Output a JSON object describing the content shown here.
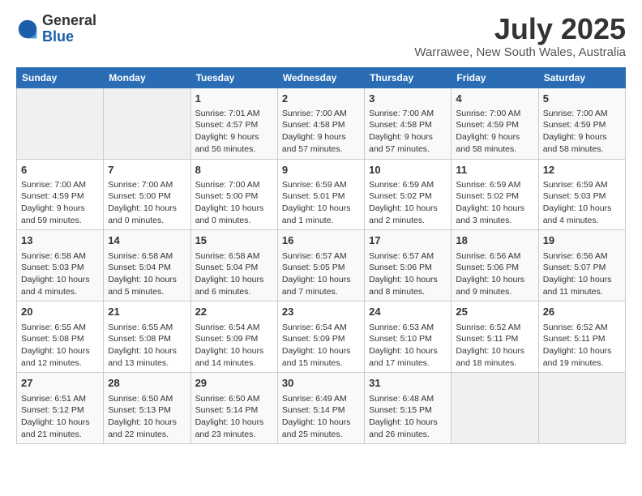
{
  "header": {
    "logo_general": "General",
    "logo_blue": "Blue",
    "month": "July 2025",
    "location": "Warrawee, New South Wales, Australia"
  },
  "days_of_week": [
    "Sunday",
    "Monday",
    "Tuesday",
    "Wednesday",
    "Thursday",
    "Friday",
    "Saturday"
  ],
  "weeks": [
    [
      {
        "day": "",
        "info": ""
      },
      {
        "day": "",
        "info": ""
      },
      {
        "day": "1",
        "info": "Sunrise: 7:01 AM\nSunset: 4:57 PM\nDaylight: 9 hours and 56 minutes."
      },
      {
        "day": "2",
        "info": "Sunrise: 7:00 AM\nSunset: 4:58 PM\nDaylight: 9 hours and 57 minutes."
      },
      {
        "day": "3",
        "info": "Sunrise: 7:00 AM\nSunset: 4:58 PM\nDaylight: 9 hours and 57 minutes."
      },
      {
        "day": "4",
        "info": "Sunrise: 7:00 AM\nSunset: 4:59 PM\nDaylight: 9 hours and 58 minutes."
      },
      {
        "day": "5",
        "info": "Sunrise: 7:00 AM\nSunset: 4:59 PM\nDaylight: 9 hours and 58 minutes."
      }
    ],
    [
      {
        "day": "6",
        "info": "Sunrise: 7:00 AM\nSunset: 4:59 PM\nDaylight: 9 hours and 59 minutes."
      },
      {
        "day": "7",
        "info": "Sunrise: 7:00 AM\nSunset: 5:00 PM\nDaylight: 10 hours and 0 minutes."
      },
      {
        "day": "8",
        "info": "Sunrise: 7:00 AM\nSunset: 5:00 PM\nDaylight: 10 hours and 0 minutes."
      },
      {
        "day": "9",
        "info": "Sunrise: 6:59 AM\nSunset: 5:01 PM\nDaylight: 10 hours and 1 minute."
      },
      {
        "day": "10",
        "info": "Sunrise: 6:59 AM\nSunset: 5:02 PM\nDaylight: 10 hours and 2 minutes."
      },
      {
        "day": "11",
        "info": "Sunrise: 6:59 AM\nSunset: 5:02 PM\nDaylight: 10 hours and 3 minutes."
      },
      {
        "day": "12",
        "info": "Sunrise: 6:59 AM\nSunset: 5:03 PM\nDaylight: 10 hours and 4 minutes."
      }
    ],
    [
      {
        "day": "13",
        "info": "Sunrise: 6:58 AM\nSunset: 5:03 PM\nDaylight: 10 hours and 4 minutes."
      },
      {
        "day": "14",
        "info": "Sunrise: 6:58 AM\nSunset: 5:04 PM\nDaylight: 10 hours and 5 minutes."
      },
      {
        "day": "15",
        "info": "Sunrise: 6:58 AM\nSunset: 5:04 PM\nDaylight: 10 hours and 6 minutes."
      },
      {
        "day": "16",
        "info": "Sunrise: 6:57 AM\nSunset: 5:05 PM\nDaylight: 10 hours and 7 minutes."
      },
      {
        "day": "17",
        "info": "Sunrise: 6:57 AM\nSunset: 5:06 PM\nDaylight: 10 hours and 8 minutes."
      },
      {
        "day": "18",
        "info": "Sunrise: 6:56 AM\nSunset: 5:06 PM\nDaylight: 10 hours and 9 minutes."
      },
      {
        "day": "19",
        "info": "Sunrise: 6:56 AM\nSunset: 5:07 PM\nDaylight: 10 hours and 11 minutes."
      }
    ],
    [
      {
        "day": "20",
        "info": "Sunrise: 6:55 AM\nSunset: 5:08 PM\nDaylight: 10 hours and 12 minutes."
      },
      {
        "day": "21",
        "info": "Sunrise: 6:55 AM\nSunset: 5:08 PM\nDaylight: 10 hours and 13 minutes."
      },
      {
        "day": "22",
        "info": "Sunrise: 6:54 AM\nSunset: 5:09 PM\nDaylight: 10 hours and 14 minutes."
      },
      {
        "day": "23",
        "info": "Sunrise: 6:54 AM\nSunset: 5:09 PM\nDaylight: 10 hours and 15 minutes."
      },
      {
        "day": "24",
        "info": "Sunrise: 6:53 AM\nSunset: 5:10 PM\nDaylight: 10 hours and 17 minutes."
      },
      {
        "day": "25",
        "info": "Sunrise: 6:52 AM\nSunset: 5:11 PM\nDaylight: 10 hours and 18 minutes."
      },
      {
        "day": "26",
        "info": "Sunrise: 6:52 AM\nSunset: 5:11 PM\nDaylight: 10 hours and 19 minutes."
      }
    ],
    [
      {
        "day": "27",
        "info": "Sunrise: 6:51 AM\nSunset: 5:12 PM\nDaylight: 10 hours and 21 minutes."
      },
      {
        "day": "28",
        "info": "Sunrise: 6:50 AM\nSunset: 5:13 PM\nDaylight: 10 hours and 22 minutes."
      },
      {
        "day": "29",
        "info": "Sunrise: 6:50 AM\nSunset: 5:14 PM\nDaylight: 10 hours and 23 minutes."
      },
      {
        "day": "30",
        "info": "Sunrise: 6:49 AM\nSunset: 5:14 PM\nDaylight: 10 hours and 25 minutes."
      },
      {
        "day": "31",
        "info": "Sunrise: 6:48 AM\nSunset: 5:15 PM\nDaylight: 10 hours and 26 minutes."
      },
      {
        "day": "",
        "info": ""
      },
      {
        "day": "",
        "info": ""
      }
    ]
  ]
}
